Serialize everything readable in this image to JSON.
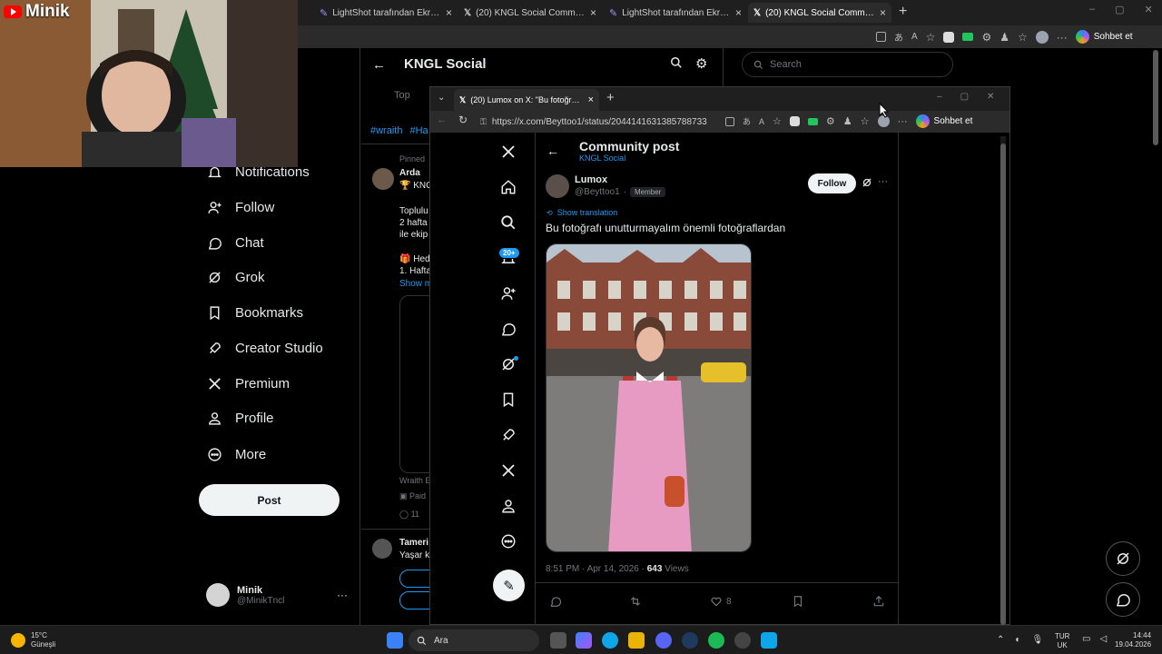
{
  "stream": {
    "channel_name": "Minik"
  },
  "browser": {
    "tabs": [
      {
        "label": "LightShot tarafından Ekran Görüntüsü",
        "icon": "feather-icon"
      },
      {
        "label": "(20) KNGL Social Community / X",
        "icon": "x-logo-icon"
      },
      {
        "label": "LightShot tarafından Ekran Görüntüsü",
        "icon": "feather-icon"
      },
      {
        "label": "(20) KNGL Social Community / X",
        "icon": "x-logo-icon",
        "active": true
      }
    ],
    "chat_button": "Sohbet et"
  },
  "background_page": {
    "header_title": "KNGL Social",
    "search_placeholder": "Search",
    "tab_top": "Top",
    "hashtags": [
      "#wraith",
      "#Ha"
    ],
    "nav": [
      {
        "label": "Notifications",
        "icon": "bell-icon"
      },
      {
        "label": "Follow",
        "icon": "add-user-icon"
      },
      {
        "label": "Chat",
        "icon": "chat-icon"
      },
      {
        "label": "Grok",
        "icon": "grok-icon"
      },
      {
        "label": "Bookmarks",
        "icon": "bookmark-icon"
      },
      {
        "label": "Creator Studio",
        "icon": "rocket-icon"
      },
      {
        "label": "Premium",
        "icon": "x-logo-icon"
      },
      {
        "label": "Profile",
        "icon": "person-icon"
      },
      {
        "label": "More",
        "icon": "more-circle-icon"
      }
    ],
    "post_button": "Post",
    "account": {
      "name": "Minik",
      "handle": "@MinikTncl"
    },
    "feed_fragments": {
      "pinned": "Pinned",
      "author": "Arda",
      "kngl": "KNG",
      "line1": "Toplulu",
      "line2": "2 hafta",
      "line3": "ile ekip",
      "line4": "Hed",
      "line5": "1. Hafta",
      "show_more": "Show m",
      "wraith": "Wraith E",
      "paid": "Paid",
      "replies": "11",
      "tameri": "Tameri",
      "yasar": "Yaşar k"
    }
  },
  "popup": {
    "tab_label": "(20) Lumox on X: \"Bu fotoğrafı unu",
    "url": "https://x.com/Beyttoo1/status/2044141631385788733",
    "chat_button": "Sohbet et",
    "notification_badge": "20+",
    "post_header": {
      "title": "Community post",
      "community": "KNGL Social"
    },
    "author": {
      "name": "Lumox",
      "handle": "@Beyttoo1",
      "separator": "·",
      "role_badge": "Member"
    },
    "follow_button": "Follow",
    "show_translation": "Show translation",
    "text": "Bu fotoğrafı unutturmayalım önemli fotoğraflardan",
    "meta": {
      "time": "8:51 PM · Apr 14, 2026 · ",
      "views_count": "643",
      "views_label": " Views"
    },
    "likes": "8"
  },
  "taskbar": {
    "weather_temp": "15°C",
    "weather_place": "Güneşli",
    "search_label": "Ara",
    "lang": "TUR",
    "lang_region": "UK",
    "time": "14:44",
    "date": "19.04.2026"
  },
  "colors": {
    "x_blue": "#1d9bf0",
    "background": "#000000",
    "text": "#e7e9ea",
    "muted": "#71767b"
  }
}
